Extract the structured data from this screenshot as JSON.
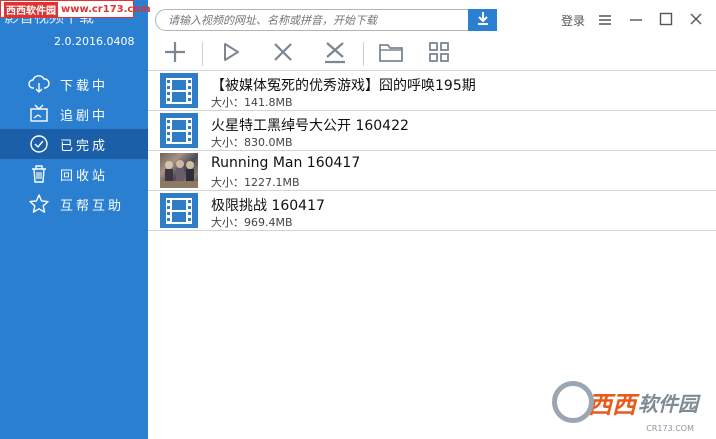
{
  "watermark_top": {
    "site": "西西软件园",
    "url": "www.cr173.com"
  },
  "app": {
    "title": "影音视频下载",
    "version": "2.0.2016.0408"
  },
  "sidebar": {
    "items": [
      {
        "label": "下载中"
      },
      {
        "label": "追剧中"
      },
      {
        "label": "已完成",
        "active": true
      },
      {
        "label": "回收站"
      },
      {
        "label": "互帮互助"
      }
    ]
  },
  "search": {
    "placeholder": "请输入视频的网址、名称或拼音，开始下载"
  },
  "header": {
    "login_label": "登录"
  },
  "toolbar": {
    "icons": [
      "add-icon",
      "play-icon",
      "delete-icon",
      "remove-icon",
      "folder-icon",
      "grid-icon"
    ]
  },
  "list": {
    "size_prefix": "大小：",
    "items": [
      {
        "title": "【被媒体冤死的优秀游戏】囧的呼唤195期",
        "size": "大小：141.8MB",
        "thumb": "film"
      },
      {
        "title": "火星特工黑绰号大公开 160422",
        "size": "大小：830.0MB",
        "thumb": "film"
      },
      {
        "title": "Running Man 160417",
        "size": "大小：1227.1MB",
        "thumb": "photo"
      },
      {
        "title": "极限挑战 160417",
        "size": "大小：969.4MB",
        "thumb": "film"
      }
    ]
  },
  "watermark_br": {
    "brand": "西西",
    "text": "软件园",
    "small": "CR173.COM"
  },
  "colors": {
    "sidebar": "#2b7fd1",
    "active": "#1a5fa8",
    "thumb": "#2f7cc7"
  }
}
